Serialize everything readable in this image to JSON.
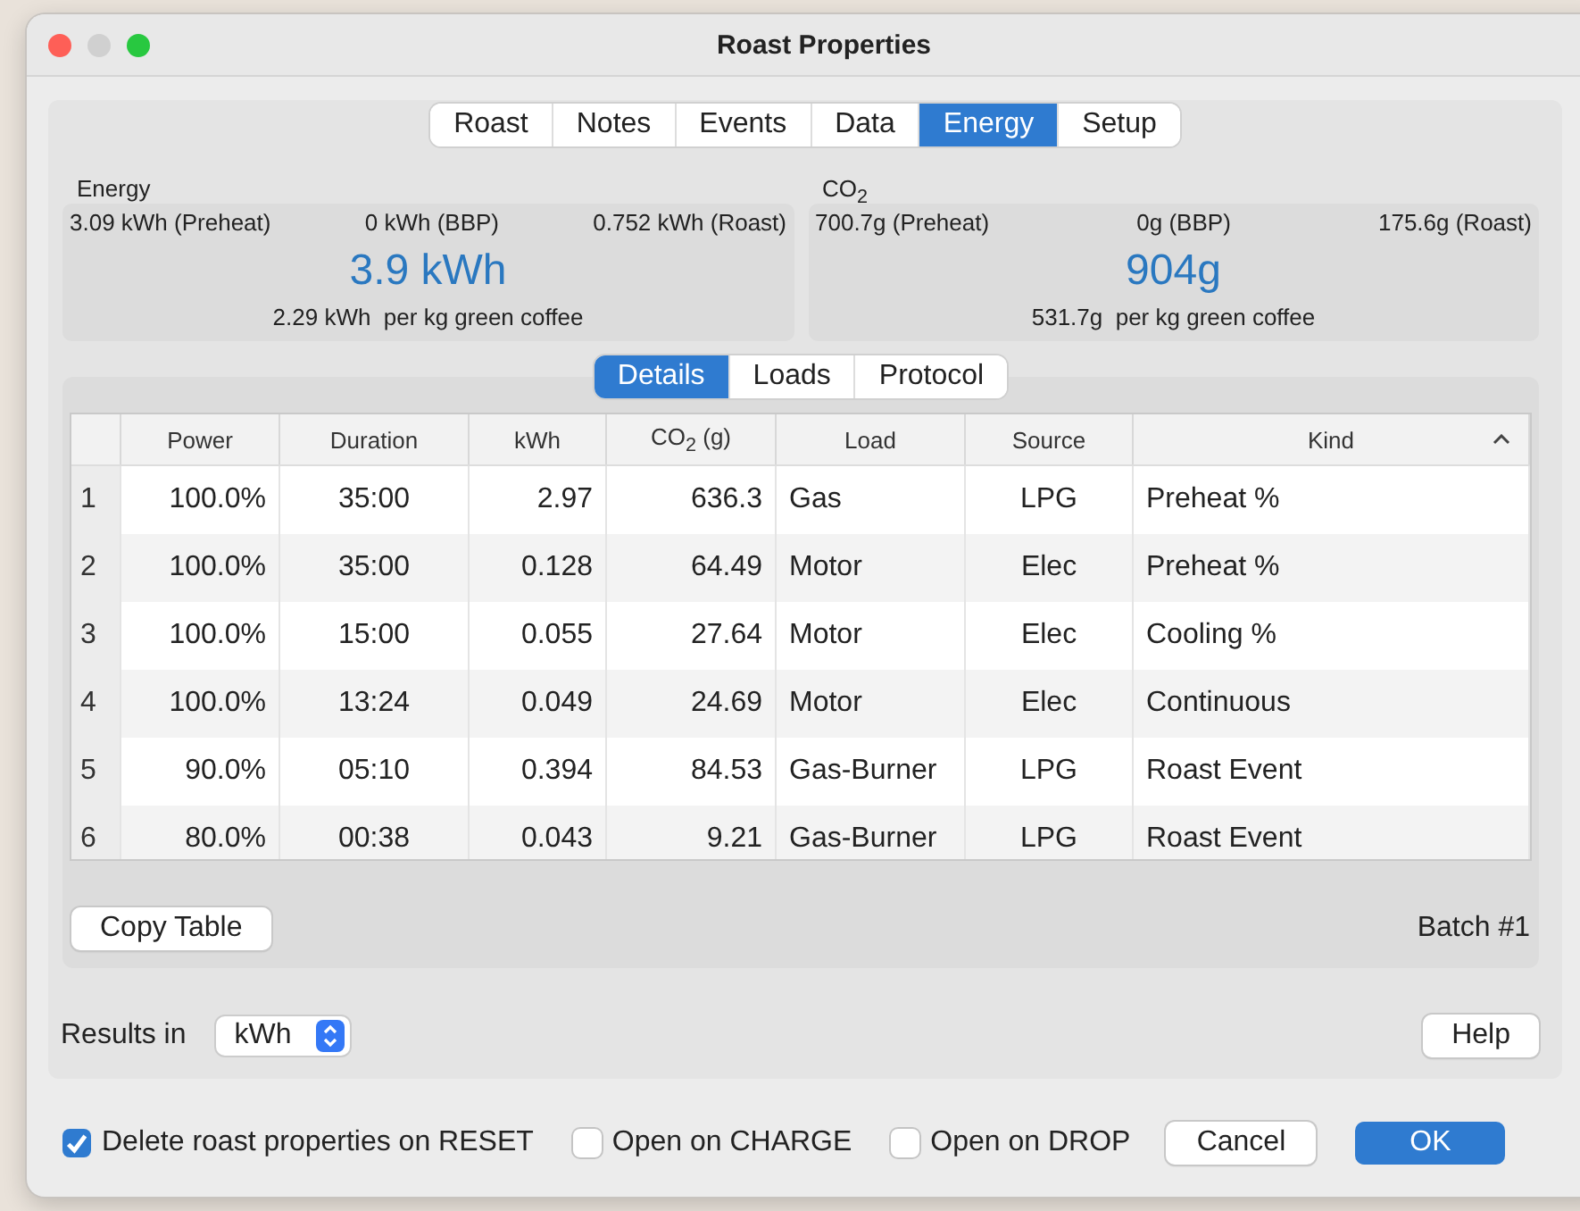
{
  "window": {
    "title": "Roast Properties"
  },
  "tabs": [
    {
      "label": "Roast",
      "selected": false
    },
    {
      "label": "Notes",
      "selected": false
    },
    {
      "label": "Events",
      "selected": false
    },
    {
      "label": "Data",
      "selected": false
    },
    {
      "label": "Energy",
      "selected": true
    },
    {
      "label": "Setup",
      "selected": false
    }
  ],
  "summaries": [
    {
      "title": "Energy",
      "parts": [
        "3.09 kWh (Preheat)",
        "0 kWh (BBP)",
        "0.752 kWh (Roast)"
      ],
      "total": "3.9 kWh",
      "per_kg": "2.29 kWh  per kg green coffee"
    },
    {
      "title": "CO$_{2}$",
      "parts": [
        "700.7g (Preheat)",
        "0g (BBP)",
        "175.6g (Roast)"
      ],
      "total": "904g",
      "per_kg": "531.7g  per kg green coffee"
    }
  ],
  "subtabs": [
    {
      "label": "Details",
      "selected": true
    },
    {
      "label": "Loads",
      "selected": false
    },
    {
      "label": "Protocol",
      "selected": false
    }
  ],
  "table": {
    "columns": [
      {
        "sorted": false
      },
      {
        "label": "Power",
        "sorted": false
      },
      {
        "label": "Duration",
        "sorted": false
      },
      {
        "label": "kWh",
        "sorted": false
      },
      {
        "label": "CO$_{2}$ (g)",
        "sorted": false
      },
      {
        "label": "Load",
        "sorted": false
      },
      {
        "label": "Source",
        "sorted": false
      },
      {
        "label": "Kind",
        "sorted": true
      }
    ],
    "rows": [
      [
        "1",
        "100.0%",
        "35:00",
        "2.97",
        "636.3",
        "Gas",
        "LPG",
        "Preheat %"
      ],
      [
        "2",
        "100.0%",
        "35:00",
        "0.128",
        "64.49",
        "Motor",
        "Elec",
        "Preheat %"
      ],
      [
        "3",
        "100.0%",
        "15:00",
        "0.055",
        "27.64",
        "Motor",
        "Elec",
        "Cooling %"
      ],
      [
        "4",
        "100.0%",
        "13:24",
        "0.049",
        "24.69",
        "Motor",
        "Elec",
        "Continuous"
      ],
      [
        "5",
        "90.0%",
        "05:10",
        "0.394",
        "84.53",
        "Gas-Burner",
        "LPG",
        "Roast Event"
      ],
      [
        "6",
        "80.0%",
        "00:38",
        "0.043",
        "9.21",
        "Gas-Burner",
        "LPG",
        "Roast Event"
      ]
    ]
  },
  "copy_button": "Copy Table",
  "batch": "Batch #1",
  "results": {
    "label": "Results in",
    "value": "kWh"
  },
  "help_button": "Help",
  "options": [
    {
      "label": "Delete roast properties on RESET",
      "checked": true
    },
    {
      "label": "Open on CHARGE",
      "checked": false
    },
    {
      "label": "Open on DROP",
      "checked": false
    }
  ],
  "buttons": [
    {
      "label": "Cancel",
      "kind": "normal"
    },
    {
      "label": "OK",
      "kind": "default"
    }
  ]
}
